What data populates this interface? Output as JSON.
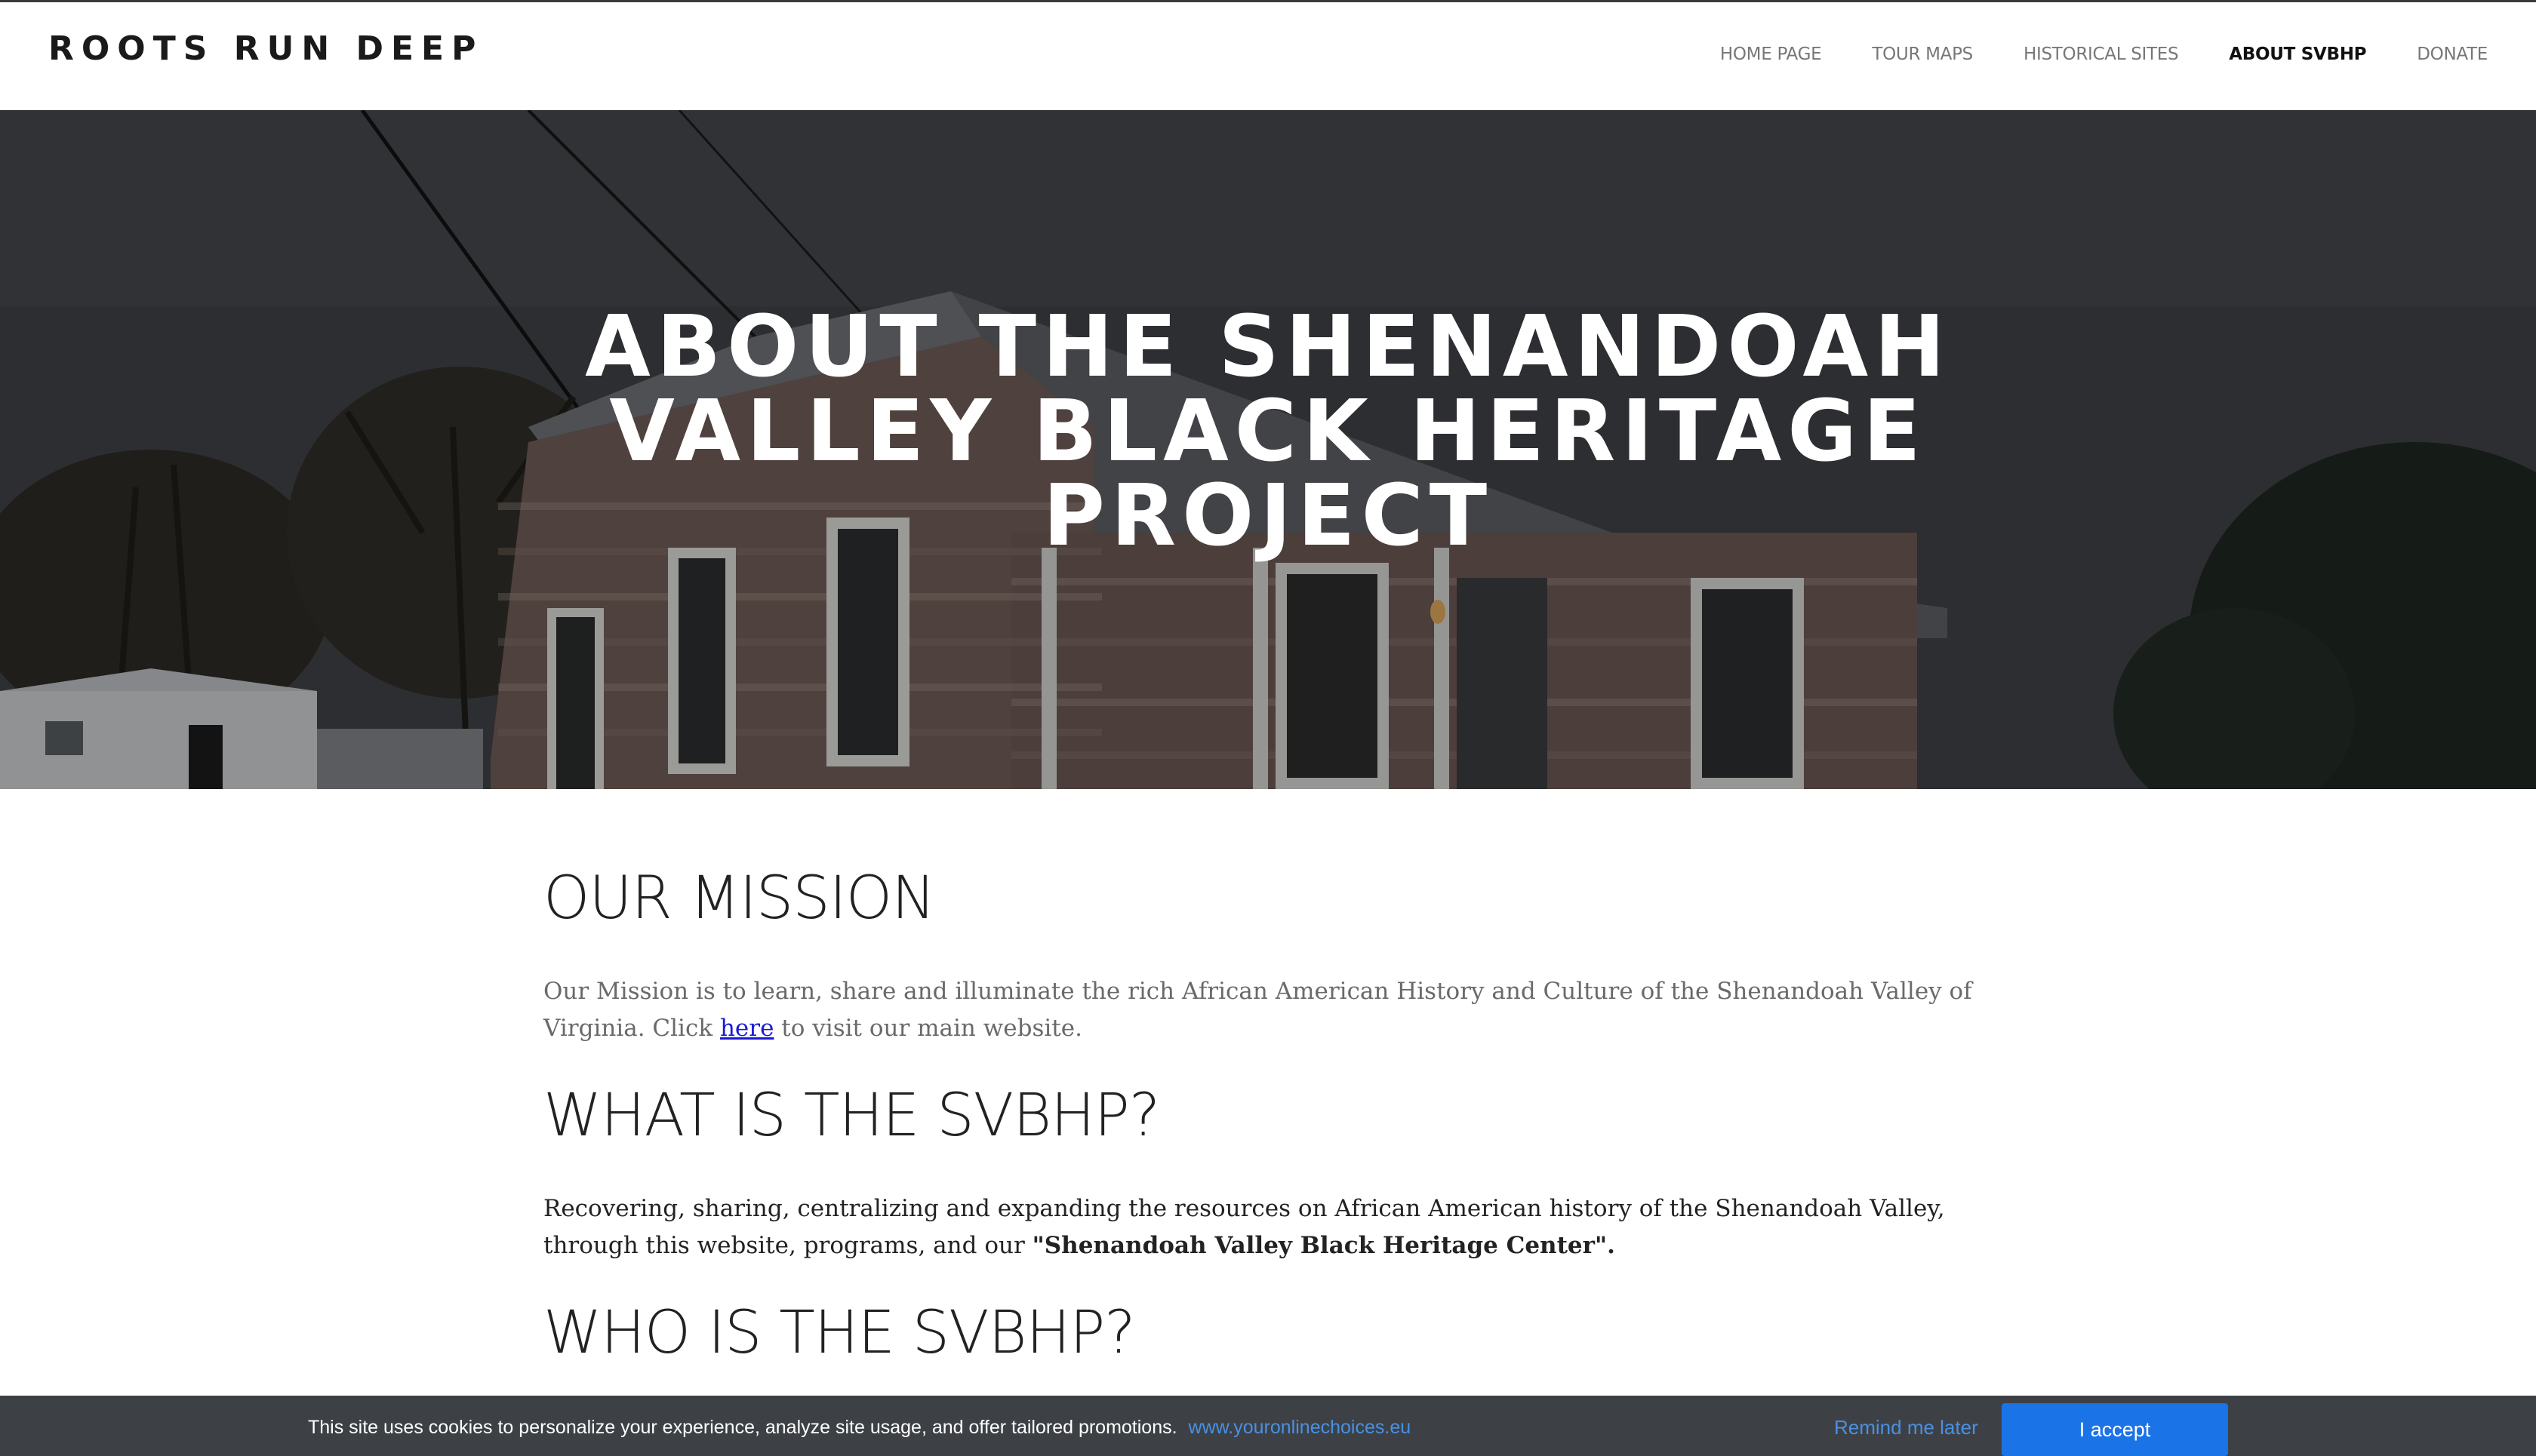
{
  "site": {
    "logo": "ROOTS RUN DEEP"
  },
  "nav": {
    "items": [
      {
        "label": "HOME PAGE"
      },
      {
        "label": "TOUR MAPS"
      },
      {
        "label": "HISTORICAL SITES"
      },
      {
        "label": "ABOUT SVBHP",
        "active": true
      },
      {
        "label": "DONATE"
      }
    ]
  },
  "hero": {
    "title": "ABOUT THE SHENANDOAH VALLEY BLACK HERITAGE PROJECT"
  },
  "content": {
    "mission_heading": "OUR MISSION",
    "mission_text_before": "Our Mission is to learn, share and illuminate the rich African American History and Culture of the Shenandoah Valley of Virginia. Click ",
    "mission_link": "here",
    "mission_text_after": " to visit our main website.",
    "what_heading": "WHAT IS THE SVBHP?",
    "what_text": "Recovering, sharing, centralizing and expanding the resources on African American history of the Shenandoah Valley, through this website, programs,  and our ",
    "what_text_bold": "\"Shenandoah Valley Black Heritage Center\".",
    "who_heading": "WHO IS THE SVBHP?"
  },
  "cookie_banner": {
    "text": "This site uses cookies to personalize your experience, analyze site usage, and offer tailored promotions.",
    "link": "www.youronlinechoices.eu",
    "remind_label": "Remind me later",
    "accept_label": "I accept"
  },
  "colors": {
    "accent_button": "#1b73e8",
    "link": "#4a90e2",
    "banner_bg": "#3d4146"
  }
}
